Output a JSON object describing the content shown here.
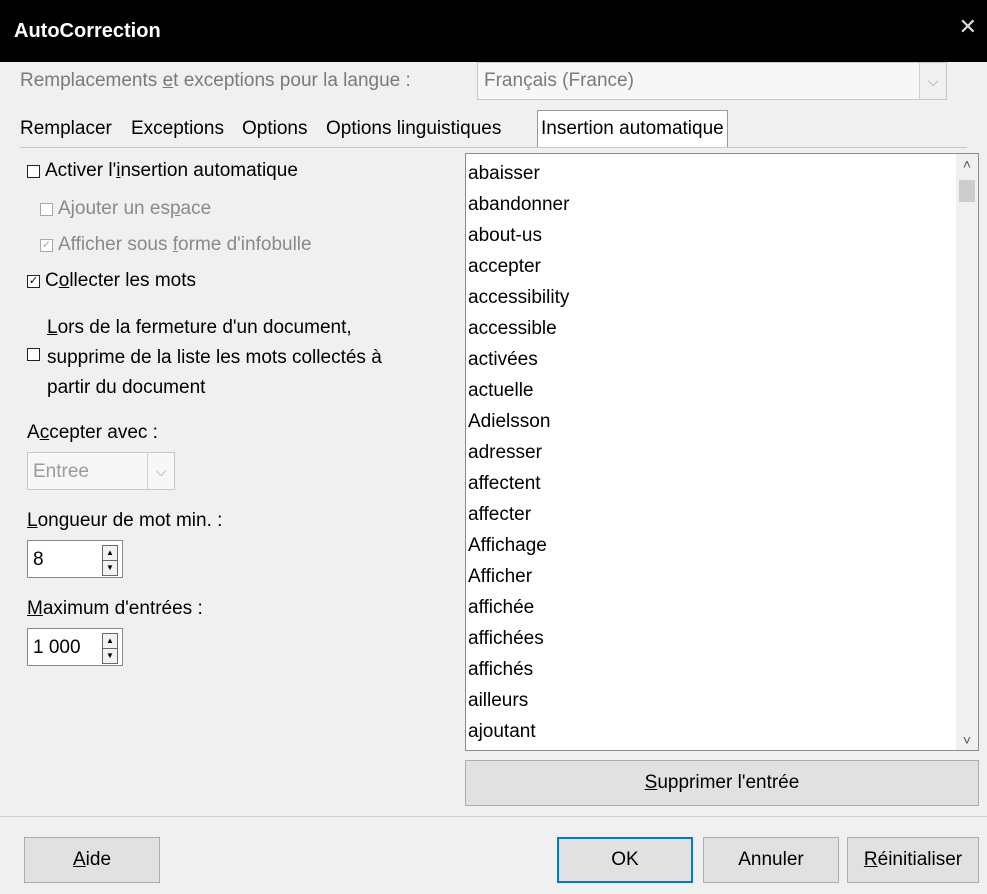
{
  "window": {
    "title": "AutoCorrection",
    "close_glyph": "✕"
  },
  "language": {
    "label_pre": "Remplacements ",
    "label_u": "e",
    "label_post": "t exceptions pour la langue :",
    "value": "Français (France)"
  },
  "tabs": [
    {
      "label": "Remplacer"
    },
    {
      "label": "Exceptions"
    },
    {
      "label": "Options"
    },
    {
      "label": "Options linguistiques"
    },
    {
      "label": "Insertion automatique"
    }
  ],
  "options": {
    "activate": {
      "pre": "Activer l'",
      "u": "i",
      "post": "nsertion automatique",
      "checked": false
    },
    "add_space": {
      "pre": "Ajouter un es",
      "u": "p",
      "post": "ace",
      "checked": false
    },
    "show_tooltip": {
      "pre": "Afficher sous ",
      "u": "f",
      "post": "orme d'infobulle",
      "checked": true
    },
    "collect": {
      "pre": "C",
      "u": "o",
      "post": "llecter les mots",
      "checked": true
    },
    "remove_on_close": {
      "line1_u": "L",
      "line1_rest": "ors de la fermeture d'un document,",
      "line2": "supprime de la liste les mots collectés à",
      "line3": "partir du document",
      "checked": false
    }
  },
  "accept": {
    "pre": "A",
    "u": "c",
    "post": "cepter avec :",
    "value": "Entree"
  },
  "min_length": {
    "u": "L",
    "post": "ongueur de mot min. :",
    "value": "8"
  },
  "max_entries": {
    "u": "M",
    "post": "aximum d'entrées :",
    "value": "1 000"
  },
  "words": [
    "abaisser",
    "abandonner",
    "about-us",
    "accepter",
    "accessibility",
    "accessible",
    "activées",
    "actuelle",
    "Adielsson",
    "adresser",
    "affectent",
    "affecter",
    "Affichage",
    "Afficher",
    "affichée",
    "affichées",
    "affichés",
    "ailleurs",
    "ajoutant"
  ],
  "delete_entry": {
    "u": "S",
    "post": "upprimer l'entrée"
  },
  "footer": {
    "help": {
      "u": "A",
      "post": "ide"
    },
    "ok": "OK",
    "cancel": "Annuler",
    "reset": {
      "u": "R",
      "post": "éinitialiser"
    }
  }
}
